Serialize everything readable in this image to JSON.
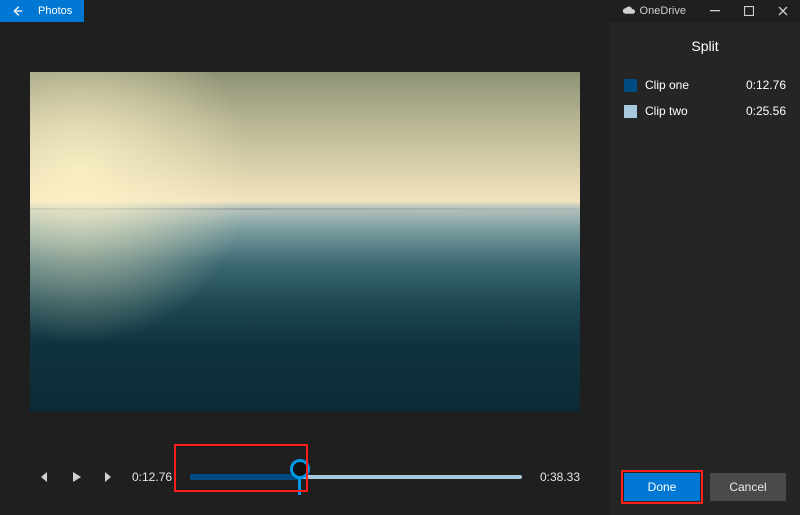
{
  "titlebar": {
    "app_name": "Photos",
    "cloud_label": "OneDrive"
  },
  "player": {
    "clip1_percent": 33,
    "current_time": "0:12.76",
    "total_time": "0:38.33"
  },
  "sidepanel": {
    "title": "Split",
    "clips": [
      {
        "label": "Clip one",
        "duration": "0:12.76",
        "color": "#004b82"
      },
      {
        "label": "Clip two",
        "duration": "0:25.56",
        "color": "#a8c8dd"
      }
    ],
    "done_label": "Done",
    "cancel_label": "Cancel"
  },
  "colors": {
    "accent": "#0078d4",
    "highlight": "#ff1f1f"
  }
}
